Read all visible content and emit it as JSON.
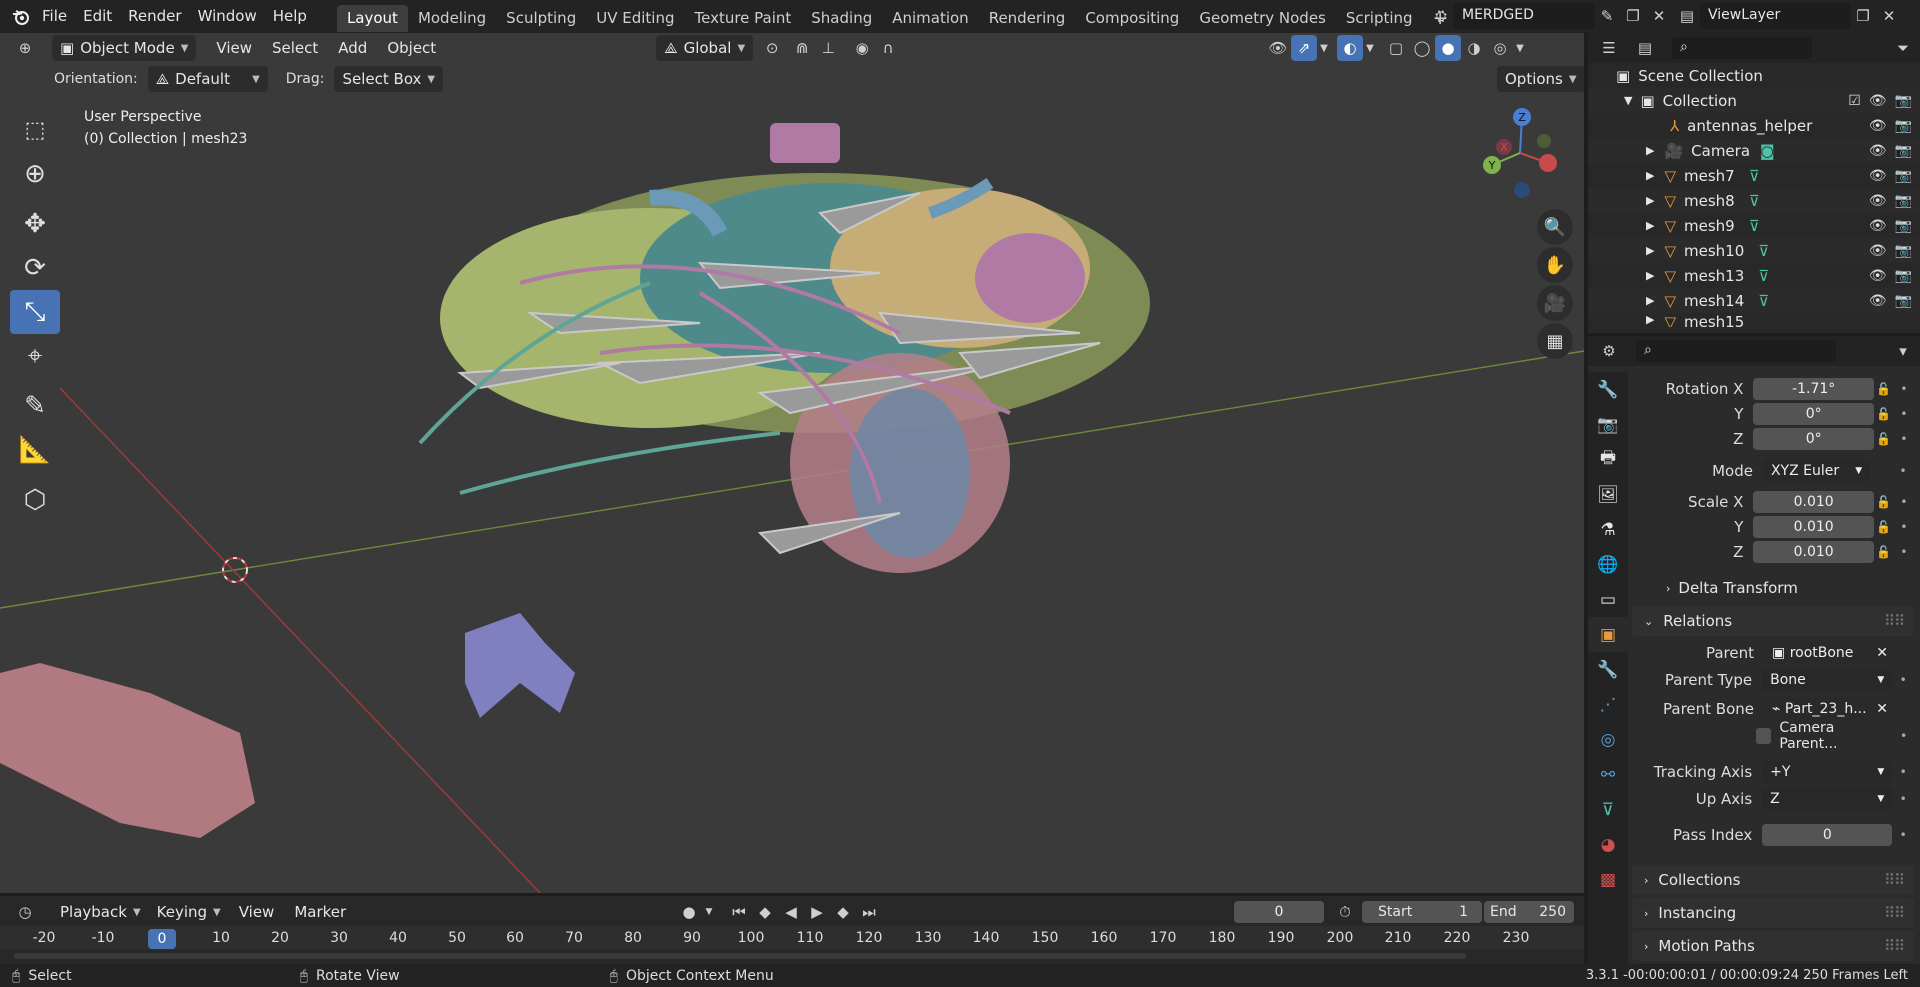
{
  "app": {
    "menus": [
      "File",
      "Edit",
      "Render",
      "Window",
      "Help"
    ],
    "workspaces": [
      "Layout",
      "Modeling",
      "Sculpting",
      "UV Editing",
      "Texture Paint",
      "Shading",
      "Animation",
      "Rendering",
      "Compositing",
      "Geometry Nodes",
      "Scripting"
    ],
    "active_workspace": "Layout",
    "add_workspace": "+",
    "scene_name": "MERDGED",
    "view_layer": "ViewLayer"
  },
  "viewport": {
    "mode": "Object Mode",
    "menus": [
      "View",
      "Select",
      "Add",
      "Object"
    ],
    "transform_orientation": "Global",
    "orientation_label": "Orientation:",
    "orientation_value": "Default",
    "drag_label": "Drag:",
    "drag_value": "Select Box",
    "options_label": "Options",
    "overlay_title": "User Perspective",
    "overlay_subtitle": "(0) Collection | mesh23",
    "gizmo_axes": {
      "x": "X",
      "y": "Y",
      "z": "Z"
    }
  },
  "outliner": {
    "root": "Scene Collection",
    "collection": "Collection",
    "items": [
      {
        "name": "antennas_helper",
        "icon": "armature-icon"
      },
      {
        "name": "Camera",
        "icon": "camera-icon"
      },
      {
        "name": "mesh7",
        "icon": "mesh-icon"
      },
      {
        "name": "mesh8",
        "icon": "mesh-icon"
      },
      {
        "name": "mesh9",
        "icon": "mesh-icon"
      },
      {
        "name": "mesh10",
        "icon": "mesh-icon"
      },
      {
        "name": "mesh13",
        "icon": "mesh-icon"
      },
      {
        "name": "mesh14",
        "icon": "mesh-icon"
      },
      {
        "name": "mesh15",
        "icon": "mesh-icon"
      }
    ]
  },
  "properties": {
    "rotation_x_label": "Rotation X",
    "rotation_x": "-1.71°",
    "rotation_y_label": "Y",
    "rotation_y": "0°",
    "rotation_z_label": "Z",
    "rotation_z": "0°",
    "mode_label": "Mode",
    "mode_value": "XYZ Euler",
    "scale_x_label": "Scale X",
    "scale_x": "0.010",
    "scale_y_label": "Y",
    "scale_y": "0.010",
    "scale_z_label": "Z",
    "scale_z": "0.010",
    "delta_transform": "Delta Transform",
    "relations": "Relations",
    "parent_label": "Parent",
    "parent_value": "rootBone",
    "parent_type_label": "Parent Type",
    "parent_type_value": "Bone",
    "parent_bone_label": "Parent Bone",
    "parent_bone_value": "Part_23_h...",
    "camera_parent_label": "Camera Parent...",
    "tracking_axis_label": "Tracking Axis",
    "tracking_axis_value": "+Y",
    "up_axis_label": "Up Axis",
    "up_axis_value": "Z",
    "pass_index_label": "Pass Index",
    "pass_index_value": "0",
    "collections": "Collections",
    "instancing": "Instancing",
    "motion_paths": "Motion Paths"
  },
  "timeline": {
    "menus": [
      "Playback",
      "Keying",
      "View",
      "Marker"
    ],
    "current_frame": "0",
    "start_label": "Start",
    "start_value": "1",
    "end_label": "End",
    "end_value": "250",
    "ruler": [
      "-20",
      "-10",
      "0",
      "10",
      "20",
      "30",
      "40",
      "50",
      "60",
      "70",
      "80",
      "90",
      "100",
      "110",
      "120",
      "130",
      "140",
      "150",
      "160",
      "170",
      "180",
      "190",
      "200",
      "210",
      "220",
      "230"
    ]
  },
  "statusbar": {
    "select": "Select",
    "rotate_view": "Rotate View",
    "context_menu": "Object Context Menu",
    "version_info": "3.3.1 -00:00:00:01 / 00:00:09:24  250 Frames Left"
  }
}
